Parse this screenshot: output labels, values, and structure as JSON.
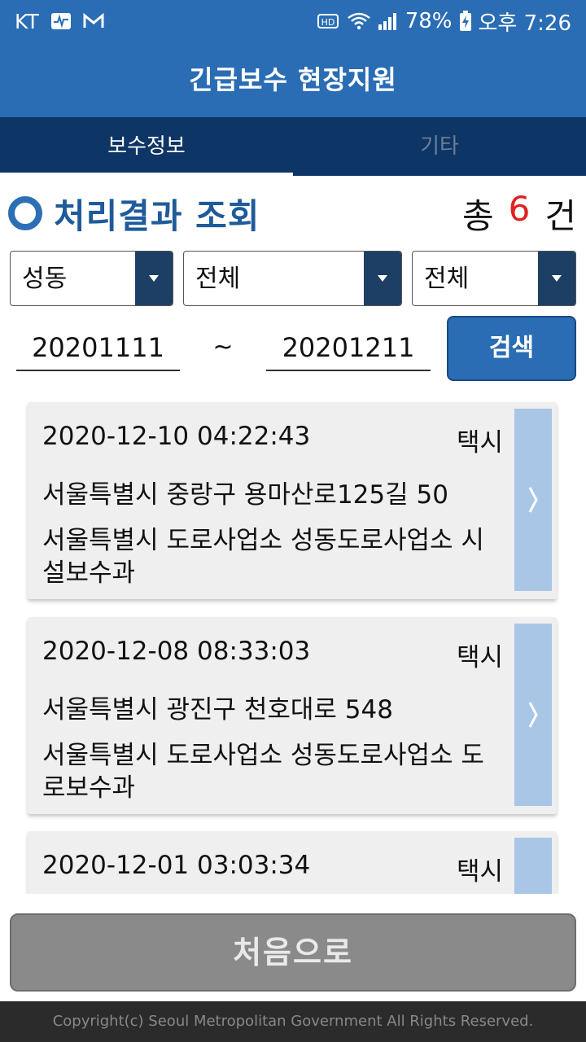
{
  "status_bar": {
    "carrier": "KT",
    "battery": "78%",
    "time": "오후 7:26",
    "hd_label": "HD"
  },
  "app": {
    "title": "긴급보수 현장지원"
  },
  "tabs": [
    {
      "label": "보수정보",
      "active": true
    },
    {
      "label": "기타",
      "active": false
    }
  ],
  "header": {
    "title": "처리결과 조회",
    "total_prefix": "총",
    "total_count": "6",
    "total_suffix": "건"
  },
  "filters": {
    "district": "성동",
    "category": "전체",
    "status": "전체"
  },
  "date_range": {
    "from": "20201111",
    "separator": "~",
    "to": "20201211"
  },
  "search_label": "검색",
  "results": [
    {
      "datetime": "2020-12-10 04:22:43",
      "type": "택시",
      "address": "서울특별시 중랑구 용마산로125길 50",
      "org": "서울특별시 도로사업소 성동도로사업소 시설보수과"
    },
    {
      "datetime": "2020-12-08 08:33:03",
      "type": "택시",
      "address": "서울특별시 광진구 천호대로 548",
      "org": "서울특별시 도로사업소 성동도로사업소 도로보수과"
    },
    {
      "datetime": "2020-12-01 03:03:34",
      "type": "택시"
    }
  ],
  "home_button": "처음으로",
  "footer": "Copyright(c) Seoul Metropolitan Government All Rights Reserved.",
  "colors": {
    "primary": "#2a6db4",
    "tab_bar": "#0d3565",
    "count": "#e02020",
    "card_bg": "#efeff0",
    "card_arrow": "#a9c6e6"
  }
}
